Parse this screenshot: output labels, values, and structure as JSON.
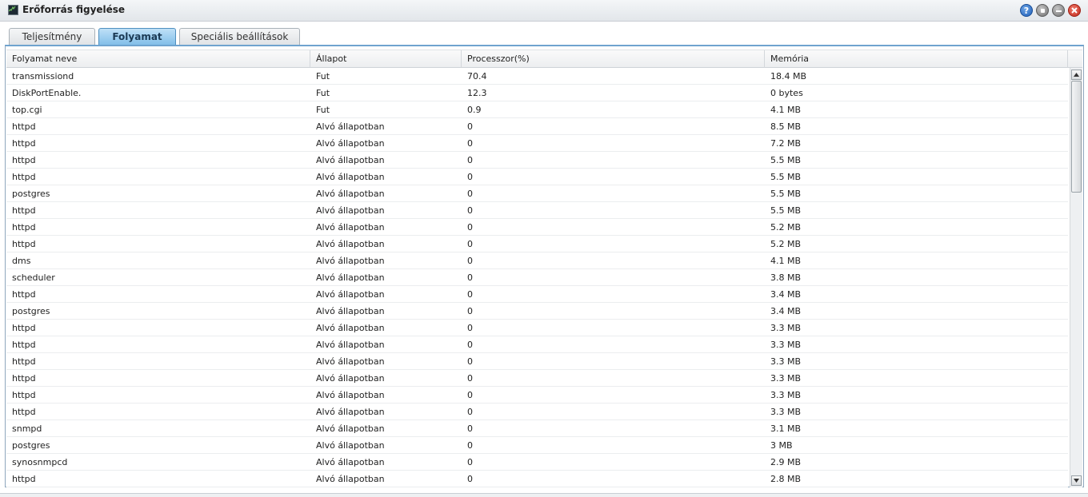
{
  "window": {
    "title": "Erőforrás figyelése",
    "icon": "monitor-icon",
    "controls": [
      "help-icon",
      "restore-icon",
      "minimize-icon",
      "close-icon"
    ],
    "help_glyph": "?"
  },
  "tabs": [
    {
      "label": "Teljesítmény",
      "active": false
    },
    {
      "label": "Folyamat",
      "active": true
    },
    {
      "label": "Speciális beállítások",
      "active": false
    }
  ],
  "table": {
    "columns": [
      "Folyamat neve",
      "Állapot",
      "Processzor(%)",
      "Memória"
    ],
    "rows": [
      [
        "transmissiond",
        "Fut",
        "70.4",
        "18.4 MB"
      ],
      [
        "DiskPortEnable.",
        "Fut",
        "12.3",
        "0 bytes"
      ],
      [
        "top.cgi",
        "Fut",
        "0.9",
        "4.1 MB"
      ],
      [
        "httpd",
        "Alvó állapotban",
        "0",
        "8.5 MB"
      ],
      [
        "httpd",
        "Alvó állapotban",
        "0",
        "7.2 MB"
      ],
      [
        "httpd",
        "Alvó állapotban",
        "0",
        "5.5 MB"
      ],
      [
        "httpd",
        "Alvó állapotban",
        "0",
        "5.5 MB"
      ],
      [
        "postgres",
        "Alvó állapotban",
        "0",
        "5.5 MB"
      ],
      [
        "httpd",
        "Alvó állapotban",
        "0",
        "5.5 MB"
      ],
      [
        "httpd",
        "Alvó állapotban",
        "0",
        "5.2 MB"
      ],
      [
        "httpd",
        "Alvó állapotban",
        "0",
        "5.2 MB"
      ],
      [
        "dms",
        "Alvó állapotban",
        "0",
        "4.1 MB"
      ],
      [
        "scheduler",
        "Alvó állapotban",
        "0",
        "3.8 MB"
      ],
      [
        "httpd",
        "Alvó állapotban",
        "0",
        "3.4 MB"
      ],
      [
        "postgres",
        "Alvó állapotban",
        "0",
        "3.4 MB"
      ],
      [
        "httpd",
        "Alvó állapotban",
        "0",
        "3.3 MB"
      ],
      [
        "httpd",
        "Alvó állapotban",
        "0",
        "3.3 MB"
      ],
      [
        "httpd",
        "Alvó állapotban",
        "0",
        "3.3 MB"
      ],
      [
        "httpd",
        "Alvó állapotban",
        "0",
        "3.3 MB"
      ],
      [
        "httpd",
        "Alvó állapotban",
        "0",
        "3.3 MB"
      ],
      [
        "httpd",
        "Alvó állapotban",
        "0",
        "3.3 MB"
      ],
      [
        "snmpd",
        "Alvó állapotban",
        "0",
        "3.1 MB"
      ],
      [
        "postgres",
        "Alvó állapotban",
        "0",
        "3 MB"
      ],
      [
        "synosnmpcd",
        "Alvó állapotban",
        "0",
        "2.9 MB"
      ],
      [
        "httpd",
        "Alvó állapotban",
        "0",
        "2.8 MB"
      ]
    ]
  },
  "colors": {
    "active_tab": "#7fbde8",
    "panel_border": "#6fa3cf",
    "close_button": "#c0281b",
    "help_button": "#1f5fb8"
  }
}
